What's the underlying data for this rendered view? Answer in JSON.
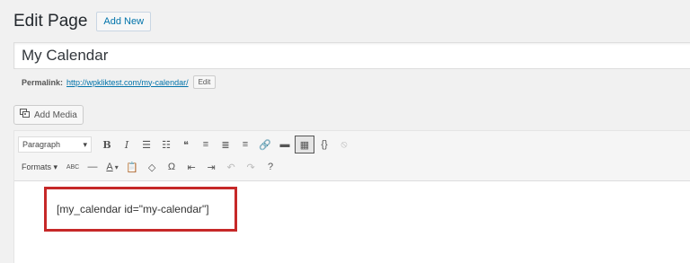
{
  "heading": {
    "title": "Edit Page",
    "add_new_label": "Add New"
  },
  "post_title": {
    "value": "My Calendar"
  },
  "permalink": {
    "label": "Permalink:",
    "url": "http://wpkliktest.com/my-calendar/",
    "edit_label": "Edit"
  },
  "media": {
    "add_media_label": "Add Media",
    "icon": "add-media-icon"
  },
  "toolbar": {
    "format_select": "Paragraph",
    "formats_label": "Formats",
    "row1_buttons": [
      {
        "name": "bold",
        "glyph": "B"
      },
      {
        "name": "italic",
        "glyph": "I"
      },
      {
        "name": "bullet-list",
        "glyph": "☰"
      },
      {
        "name": "numbered-list",
        "glyph": "☷"
      },
      {
        "name": "blockquote",
        "glyph": "❝"
      },
      {
        "name": "align-left",
        "glyph": "≡"
      },
      {
        "name": "align-center",
        "glyph": "≣"
      },
      {
        "name": "align-right",
        "glyph": "≡"
      },
      {
        "name": "insert-link",
        "glyph": "🔗"
      },
      {
        "name": "read-more",
        "glyph": "▬"
      },
      {
        "name": "toolbar-toggle",
        "glyph": "▦"
      },
      {
        "name": "code-braces",
        "glyph": "{}"
      },
      {
        "name": "remove-link",
        "glyph": "⦸"
      }
    ],
    "row2_buttons": [
      {
        "name": "strikethrough",
        "glyph": "ABC"
      },
      {
        "name": "horizontal-line",
        "glyph": "—"
      },
      {
        "name": "text-color",
        "glyph": "A"
      },
      {
        "name": "paste-as-text",
        "glyph": "📋"
      },
      {
        "name": "clear-formatting",
        "glyph": "◇"
      },
      {
        "name": "special-character",
        "glyph": "Ω"
      },
      {
        "name": "decrease-indent",
        "glyph": "⇤"
      },
      {
        "name": "increase-indent",
        "glyph": "⇥"
      },
      {
        "name": "undo",
        "glyph": "↶"
      },
      {
        "name": "redo",
        "glyph": "↷"
      },
      {
        "name": "help",
        "glyph": "?"
      }
    ]
  },
  "content": {
    "shortcode": "[my_calendar id=\"my-calendar\"]"
  },
  "colors": {
    "highlight_border": "#c62828",
    "link": "#0073aa"
  }
}
